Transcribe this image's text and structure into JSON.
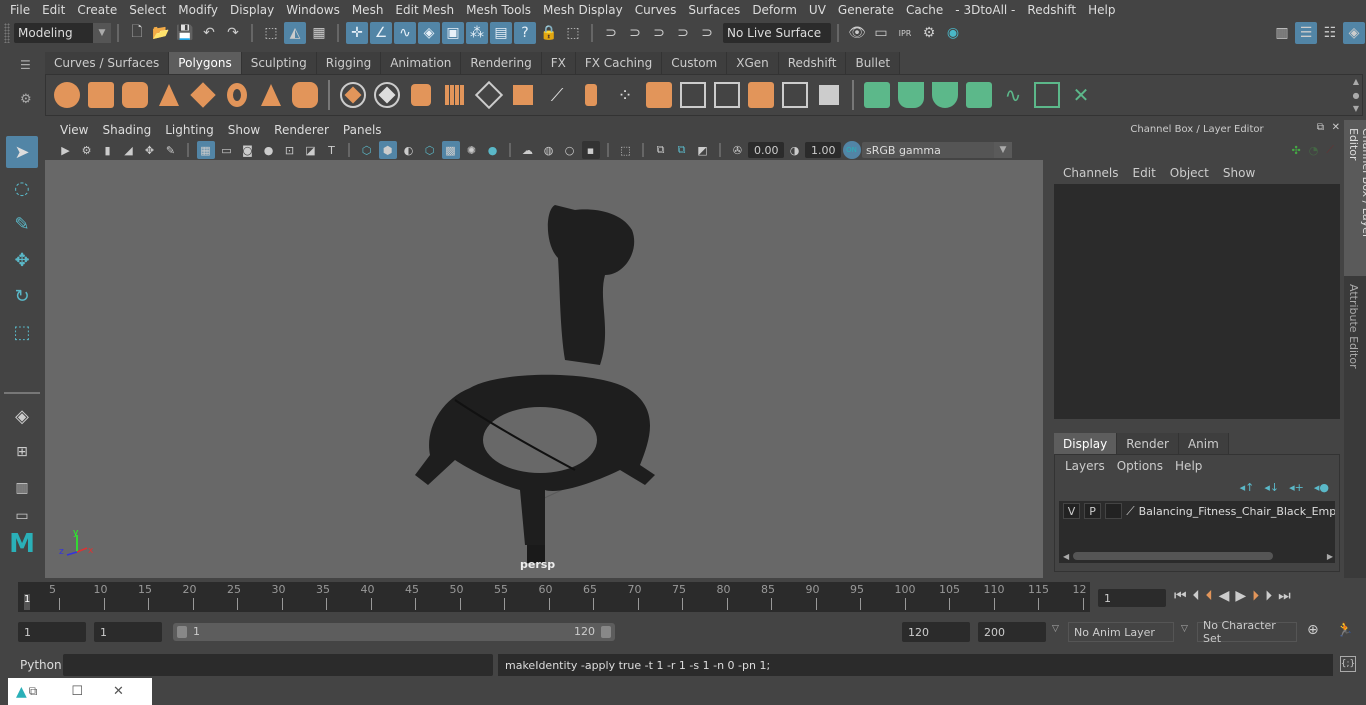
{
  "menubar": [
    "File",
    "Edit",
    "Create",
    "Select",
    "Modify",
    "Display",
    "Windows",
    "Mesh",
    "Edit Mesh",
    "Mesh Tools",
    "Mesh Display",
    "Curves",
    "Surfaces",
    "Deform",
    "UV",
    "Generate",
    "Cache",
    "- 3DtoAll -",
    "Redshift",
    "Help"
  ],
  "status": {
    "mode": "Modeling",
    "live_surface": "No Live Surface"
  },
  "shelf_tabs": [
    {
      "label": "Curves / Surfaces",
      "active": false
    },
    {
      "label": "Polygons",
      "active": true
    },
    {
      "label": "Sculpting",
      "active": false
    },
    {
      "label": "Rigging",
      "active": false
    },
    {
      "label": "Animation",
      "active": false
    },
    {
      "label": "Rendering",
      "active": false
    },
    {
      "label": "FX",
      "active": false
    },
    {
      "label": "FX Caching",
      "active": false
    },
    {
      "label": "Custom",
      "active": false
    },
    {
      "label": "XGen",
      "active": false
    },
    {
      "label": "Redshift",
      "active": false
    },
    {
      "label": "Bullet",
      "active": false
    }
  ],
  "viewport": {
    "menu": [
      "View",
      "Shading",
      "Lighting",
      "Show",
      "Renderer",
      "Panels"
    ],
    "exposure": "0.00",
    "gamma": "1.00",
    "color_space": "sRGB gamma",
    "camera_label": "persp",
    "axis": {
      "x": "x",
      "y": "y",
      "z": "z"
    }
  },
  "channel_box": {
    "title": "Channel Box / Layer Editor",
    "menu": [
      "Channels",
      "Edit",
      "Object",
      "Show"
    ]
  },
  "layer_editor": {
    "tabs": [
      {
        "label": "Display",
        "active": true
      },
      {
        "label": "Render",
        "active": false
      },
      {
        "label": "Anim",
        "active": false
      }
    ],
    "menu": [
      "Layers",
      "Options",
      "Help"
    ],
    "layers": [
      {
        "v": "V",
        "p": "P",
        "name": "Balancing_Fitness_Chair_Black_Empty"
      }
    ]
  },
  "side_tabs": [
    "Channel Box / Layer Editor",
    "Attribute Editor"
  ],
  "timeline": {
    "ticks": [
      "5",
      "10",
      "15",
      "20",
      "25",
      "30",
      "35",
      "40",
      "45",
      "50",
      "55",
      "60",
      "65",
      "70",
      "75",
      "80",
      "85",
      "90",
      "95",
      "100",
      "105",
      "110",
      "115",
      "12"
    ],
    "current_marker": "1",
    "current_frame": "1"
  },
  "range": {
    "start": "1",
    "playback_start": "1",
    "slider_start": "1",
    "slider_end": "120",
    "playback_end": "120",
    "end": "200",
    "anim_layer": "No Anim Layer",
    "character_set": "No Character Set"
  },
  "command_line": {
    "language": "Python",
    "input": "",
    "result": "makeIdentity -apply true -t 1 -r 1 -s 1 -n 0 -pn 1;"
  },
  "colors": {
    "accent": "#5285a6",
    "shelf_orange": "#e2955a",
    "shelf_green": "#5cb88a",
    "viewport_bg": "#686868"
  }
}
